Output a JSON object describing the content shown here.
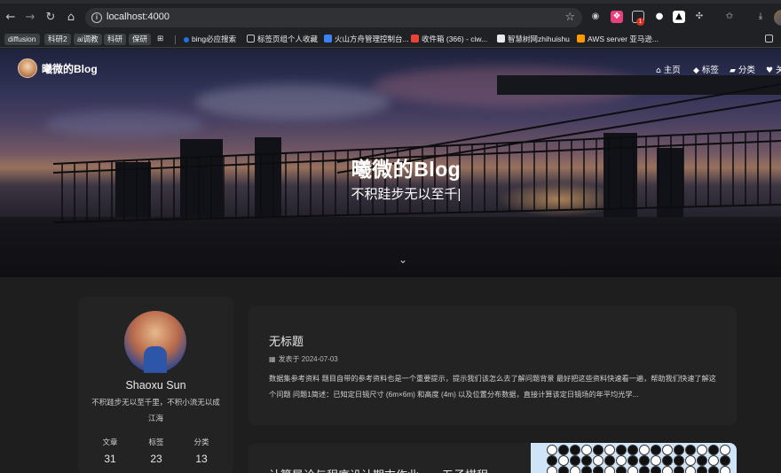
{
  "browser": {
    "url": "localhost:4000",
    "bookmarks": [
      "diffusion",
      "科研2",
      "ai调教",
      "科研",
      "保研",
      "bing必应搜索",
      "标签页组个人收藏",
      "火山方舟管理控制台...",
      "收件箱 (366) - ciw...",
      "智慧树网zhihuishu",
      "AWS server 亚马逊..."
    ]
  },
  "site": {
    "name": "曦微的Blog",
    "menu": [
      "主页",
      "标签",
      "分类",
      "关"
    ]
  },
  "hero": {
    "title": "曦微的Blog",
    "subtitle": "不积跬步无以至千|"
  },
  "profile": {
    "name": "Shaoxu Sun",
    "description": "不积跬步无以至千里，不积小流无以成",
    "location": "江海",
    "stats": [
      {
        "label": "文章",
        "value": "31"
      },
      {
        "label": "标签",
        "value": "23"
      },
      {
        "label": "分类",
        "value": "13"
      }
    ]
  },
  "posts": [
    {
      "title": "无标题",
      "date_prefix": "发表于",
      "date": "2024-07-03",
      "excerpt": "数据集参考资料 题目自带的参考资料也是一个重要提示，提示我们该怎么去了解问题背景 最好把这些资料快速看一遍，帮助我们快速了解这个问题 问题1简述：已知定日镜尺寸 (6m×6m) 和高度 (4m) 以及位置分布数据，直接计算该定日镜场的年平均光学..."
    },
    {
      "title": "计算导论与程序设计期末作业——五子棋程"
    }
  ],
  "colors": {
    "page_bg": "#1e1e1e",
    "card_bg": "#232323",
    "text": "#e8e8e8"
  }
}
